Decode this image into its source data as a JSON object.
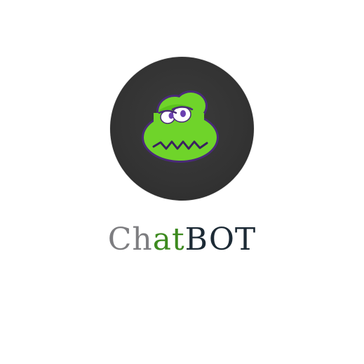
{
  "logo": {
    "icon": "frog-mascot-icon",
    "colors": {
      "circle": "#333333",
      "frog_body": "#6fd42a",
      "frog_outline": "#4a2a78",
      "eye_white": "#ffffff",
      "pupil": "#6a3fb0"
    }
  },
  "wordmark": {
    "part1": "Ch",
    "part2": "at",
    "part3": "BOT",
    "colors": {
      "part1": "#7d7d80",
      "part2": "#3d8a1f",
      "part3": "#1c2a35"
    }
  }
}
